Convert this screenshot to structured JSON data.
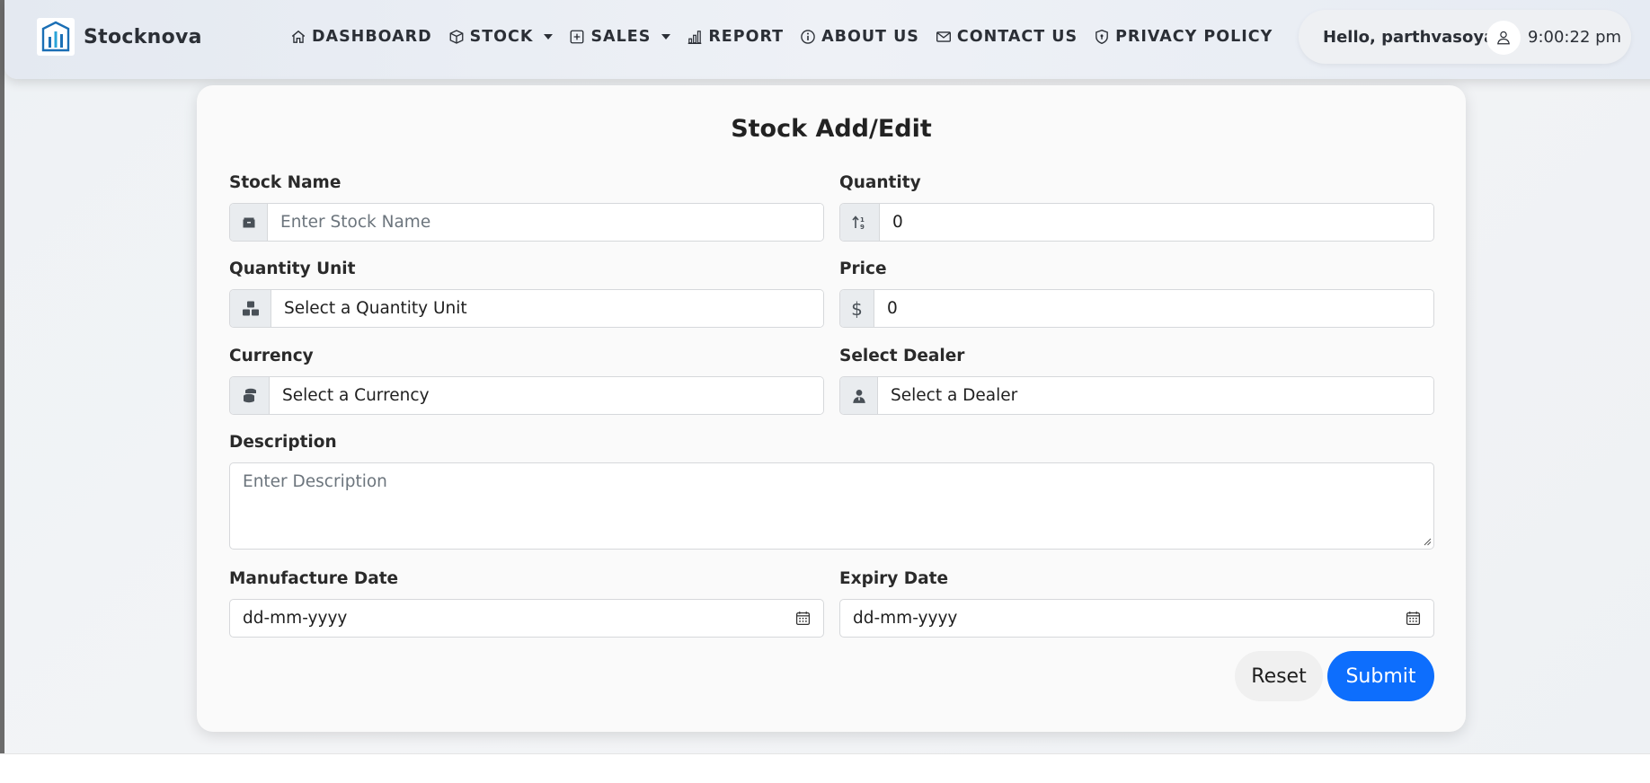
{
  "brand": {
    "name": "Stocknova",
    "logo_icon": "building-chart-logo"
  },
  "nav": {
    "items": [
      {
        "label": "DASHBOARD",
        "icon": "home-icon",
        "dropdown": false
      },
      {
        "label": "STOCK",
        "icon": "box-icon",
        "dropdown": true
      },
      {
        "label": "SALES",
        "icon": "plus-square-icon",
        "dropdown": true
      },
      {
        "label": "REPORT",
        "icon": "bar-chart-icon",
        "dropdown": false
      },
      {
        "label": "ABOUT US",
        "icon": "info-circle-icon",
        "dropdown": false
      },
      {
        "label": "CONTACT US",
        "icon": "envelope-icon",
        "dropdown": false
      },
      {
        "label": "PRIVACY POLICY",
        "icon": "shield-icon",
        "dropdown": false
      }
    ]
  },
  "user": {
    "greeting": "Hello, parthvasoya",
    "time": "9:00:22 pm",
    "avatar_icon": "person-icon"
  },
  "form": {
    "title": "Stock Add/Edit",
    "stock_name": {
      "label": "Stock Name",
      "placeholder": "Enter Stock Name",
      "value": "",
      "icon": "box-icon"
    },
    "quantity": {
      "label": "Quantity",
      "value": "0",
      "icon": "sort-numeric-icon"
    },
    "quantity_unit": {
      "label": "Quantity Unit",
      "selected": "Select a Quantity Unit",
      "icon": "boxes-icon"
    },
    "price": {
      "label": "Price",
      "value": "0",
      "icon": "dollar-icon"
    },
    "currency": {
      "label": "Currency",
      "selected": "Select a Currency",
      "icon": "coins-icon"
    },
    "dealer": {
      "label": "Select Dealer",
      "selected": "Select a Dealer",
      "icon": "person-badge-icon"
    },
    "description": {
      "label": "Description",
      "placeholder": "Enter Description",
      "value": ""
    },
    "manufacture_date": {
      "label": "Manufacture Date",
      "value": "dd-mm-yyyy",
      "icon": "calendar-icon"
    },
    "expiry_date": {
      "label": "Expiry Date",
      "value": "dd-mm-yyyy",
      "icon": "calendar-icon"
    },
    "reset_label": "Reset",
    "submit_label": "Submit"
  },
  "colors": {
    "primary": "#0d6efd",
    "addon_bg": "#e9ecef",
    "card_bg": "#fafafa"
  }
}
